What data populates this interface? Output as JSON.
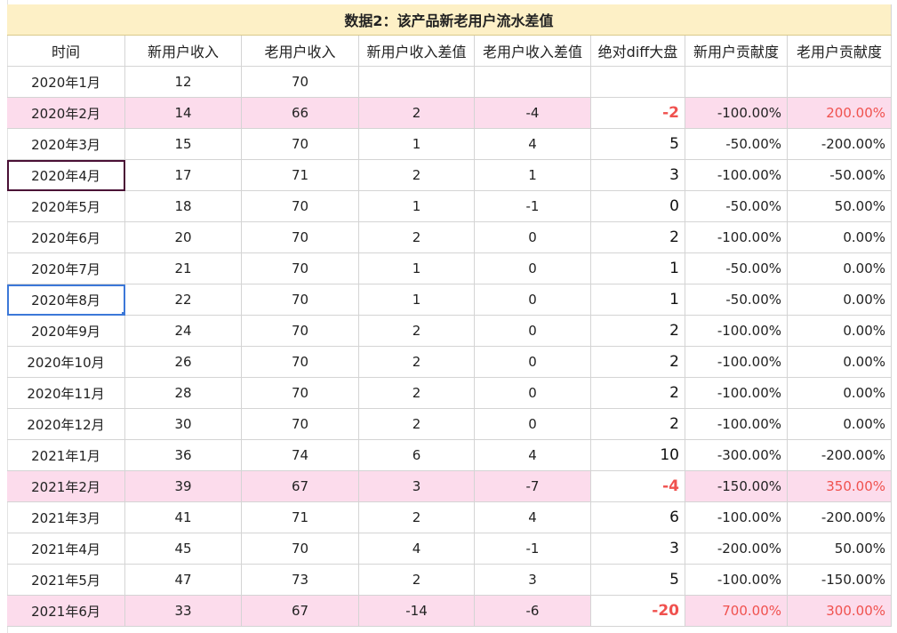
{
  "sheet": {
    "title": "数据2：该产品新老用户流水差值",
    "headers": [
      "时间",
      "新用户收入",
      "老用户收入",
      "新用户收入差值",
      "老用户收入差值",
      "绝对diff大盘",
      "新用户贡献度",
      "老用户贡献度"
    ],
    "rows": [
      {
        "month": "2020年1月",
        "new_income": "12",
        "old_income": "70",
        "new_diff": "",
        "old_diff": "",
        "abs_diff": "",
        "new_contrib": "",
        "old_contrib": "",
        "highlight": false
      },
      {
        "month": "2020年2月",
        "new_income": "14",
        "old_income": "66",
        "new_diff": "2",
        "old_diff": "-4",
        "abs_diff": "-2",
        "new_contrib": "-100.00%",
        "old_contrib": "200.00%",
        "highlight": true
      },
      {
        "month": "2020年3月",
        "new_income": "15",
        "old_income": "70",
        "new_diff": "1",
        "old_diff": "4",
        "abs_diff": "5",
        "new_contrib": "-50.00%",
        "old_contrib": "-200.00%",
        "highlight": false
      },
      {
        "month": "2020年4月",
        "new_income": "17",
        "old_income": "71",
        "new_diff": "2",
        "old_diff": "1",
        "abs_diff": "3",
        "new_contrib": "-100.00%",
        "old_contrib": "-50.00%",
        "highlight": false
      },
      {
        "month": "2020年5月",
        "new_income": "18",
        "old_income": "70",
        "new_diff": "1",
        "old_diff": "-1",
        "abs_diff": "0",
        "new_contrib": "-50.00%",
        "old_contrib": "50.00%",
        "highlight": false
      },
      {
        "month": "2020年6月",
        "new_income": "20",
        "old_income": "70",
        "new_diff": "2",
        "old_diff": "0",
        "abs_diff": "2",
        "new_contrib": "-100.00%",
        "old_contrib": "0.00%",
        "highlight": false
      },
      {
        "month": "2020年7月",
        "new_income": "21",
        "old_income": "70",
        "new_diff": "1",
        "old_diff": "0",
        "abs_diff": "1",
        "new_contrib": "-50.00%",
        "old_contrib": "0.00%",
        "highlight": false
      },
      {
        "month": "2020年8月",
        "new_income": "22",
        "old_income": "70",
        "new_diff": "1",
        "old_diff": "0",
        "abs_diff": "1",
        "new_contrib": "-50.00%",
        "old_contrib": "0.00%",
        "highlight": false
      },
      {
        "month": "2020年9月",
        "new_income": "24",
        "old_income": "70",
        "new_diff": "2",
        "old_diff": "0",
        "abs_diff": "2",
        "new_contrib": "-100.00%",
        "old_contrib": "0.00%",
        "highlight": false
      },
      {
        "month": "2020年10月",
        "new_income": "26",
        "old_income": "70",
        "new_diff": "2",
        "old_diff": "0",
        "abs_diff": "2",
        "new_contrib": "-100.00%",
        "old_contrib": "0.00%",
        "highlight": false
      },
      {
        "month": "2020年11月",
        "new_income": "28",
        "old_income": "70",
        "new_diff": "2",
        "old_diff": "0",
        "abs_diff": "2",
        "new_contrib": "-100.00%",
        "old_contrib": "0.00%",
        "highlight": false
      },
      {
        "month": "2020年12月",
        "new_income": "30",
        "old_income": "70",
        "new_diff": "2",
        "old_diff": "0",
        "abs_diff": "2",
        "new_contrib": "-100.00%",
        "old_contrib": "0.00%",
        "highlight": false
      },
      {
        "month": "2021年1月",
        "new_income": "36",
        "old_income": "74",
        "new_diff": "6",
        "old_diff": "4",
        "abs_diff": "10",
        "new_contrib": "-300.00%",
        "old_contrib": "-200.00%",
        "highlight": false
      },
      {
        "month": "2021年2月",
        "new_income": "39",
        "old_income": "67",
        "new_diff": "3",
        "old_diff": "-7",
        "abs_diff": "-4",
        "new_contrib": "-150.00%",
        "old_contrib": "350.00%",
        "highlight": true
      },
      {
        "month": "2021年3月",
        "new_income": "41",
        "old_income": "71",
        "new_diff": "2",
        "old_diff": "4",
        "abs_diff": "6",
        "new_contrib": "-100.00%",
        "old_contrib": "-200.00%",
        "highlight": false
      },
      {
        "month": "2021年4月",
        "new_income": "45",
        "old_income": "70",
        "new_diff": "4",
        "old_diff": "-1",
        "abs_diff": "3",
        "new_contrib": "-200.00%",
        "old_contrib": "50.00%",
        "highlight": false
      },
      {
        "month": "2021年5月",
        "new_income": "47",
        "old_income": "73",
        "new_diff": "2",
        "old_diff": "3",
        "abs_diff": "5",
        "new_contrib": "-100.00%",
        "old_contrib": "-150.00%",
        "highlight": false
      },
      {
        "month": "2021年6月",
        "new_income": "33",
        "old_income": "67",
        "new_diff": "-14",
        "old_diff": "-6",
        "abs_diff": "-20",
        "new_contrib": "700.00%",
        "old_contrib": "300.00%",
        "highlight": true
      }
    ]
  },
  "colors": {
    "title_bg": "#fdf0c6",
    "highlight_bg": "#fcdcec",
    "negative_text": "#f0514e",
    "selection_blue": "#3c78d8",
    "selection_dark": "#4a1035"
  }
}
